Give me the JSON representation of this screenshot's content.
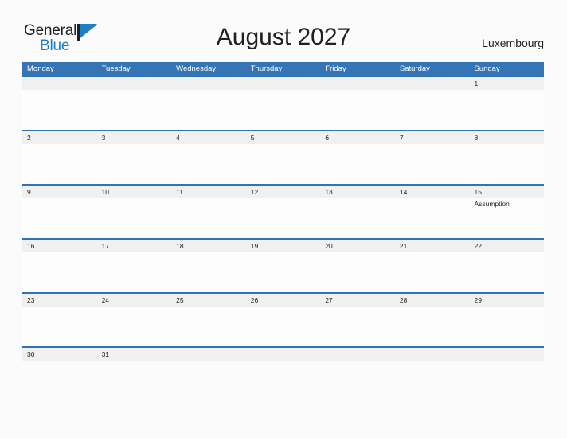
{
  "brand": {
    "name_part1": "General",
    "name_part2": "Blue",
    "flag_icon": "triangle-flag-icon",
    "color_dark": "#231f20",
    "color_blue": "#1f7fc4"
  },
  "header": {
    "title": "August 2027",
    "country": "Luxembourg"
  },
  "calendar": {
    "header_color": "#3575b5",
    "row_border_color": "#2f74b5",
    "date_strip_color": "#f0f0f0",
    "weekday_headers": [
      "Monday",
      "Tuesday",
      "Wednesday",
      "Thursday",
      "Friday",
      "Saturday",
      "Sunday"
    ],
    "weeks": [
      {
        "days": [
          {
            "date": "",
            "event": ""
          },
          {
            "date": "",
            "event": ""
          },
          {
            "date": "",
            "event": ""
          },
          {
            "date": "",
            "event": ""
          },
          {
            "date": "",
            "event": ""
          },
          {
            "date": "",
            "event": ""
          },
          {
            "date": "1",
            "event": ""
          }
        ]
      },
      {
        "days": [
          {
            "date": "2",
            "event": ""
          },
          {
            "date": "3",
            "event": ""
          },
          {
            "date": "4",
            "event": ""
          },
          {
            "date": "5",
            "event": ""
          },
          {
            "date": "6",
            "event": ""
          },
          {
            "date": "7",
            "event": ""
          },
          {
            "date": "8",
            "event": ""
          }
        ]
      },
      {
        "days": [
          {
            "date": "9",
            "event": ""
          },
          {
            "date": "10",
            "event": ""
          },
          {
            "date": "11",
            "event": ""
          },
          {
            "date": "12",
            "event": ""
          },
          {
            "date": "13",
            "event": ""
          },
          {
            "date": "14",
            "event": ""
          },
          {
            "date": "15",
            "event": "Assumption"
          }
        ]
      },
      {
        "days": [
          {
            "date": "16",
            "event": ""
          },
          {
            "date": "17",
            "event": ""
          },
          {
            "date": "18",
            "event": ""
          },
          {
            "date": "19",
            "event": ""
          },
          {
            "date": "20",
            "event": ""
          },
          {
            "date": "21",
            "event": ""
          },
          {
            "date": "22",
            "event": ""
          }
        ]
      },
      {
        "days": [
          {
            "date": "23",
            "event": ""
          },
          {
            "date": "24",
            "event": ""
          },
          {
            "date": "25",
            "event": ""
          },
          {
            "date": "26",
            "event": ""
          },
          {
            "date": "27",
            "event": ""
          },
          {
            "date": "28",
            "event": ""
          },
          {
            "date": "29",
            "event": ""
          }
        ]
      },
      {
        "days": [
          {
            "date": "30",
            "event": ""
          },
          {
            "date": "31",
            "event": ""
          },
          {
            "date": "",
            "event": ""
          },
          {
            "date": "",
            "event": ""
          },
          {
            "date": "",
            "event": ""
          },
          {
            "date": "",
            "event": ""
          },
          {
            "date": "",
            "event": ""
          }
        ]
      }
    ]
  }
}
